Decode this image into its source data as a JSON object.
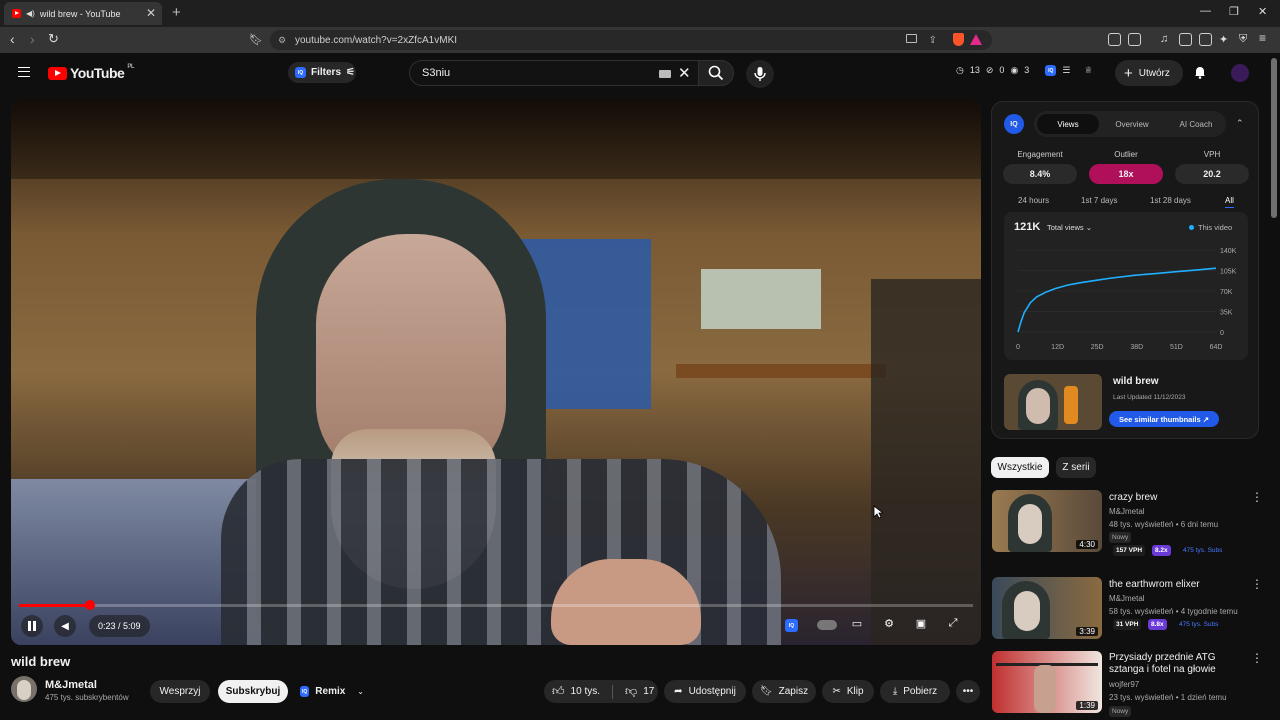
{
  "browser": {
    "tab_title": "wild brew - YouTube",
    "tab_close": "✕",
    "new_tab": "+",
    "url": "youtube.com/watch?v=2xZfcA1vMKI"
  },
  "header": {
    "logo_text": "YouTube",
    "region": "PL",
    "filters_label": "Filters",
    "iq_label": "IQ",
    "search_value": "S3niu",
    "counters": [
      "13",
      "0",
      "3"
    ],
    "create_label": "Utwórz"
  },
  "player": {
    "time": "0:23 / 5:09",
    "progress_fraction": 0.074
  },
  "video": {
    "title": "wild brew",
    "channel": "M&Jmetal",
    "subs": "475 tys. subskrybentów",
    "support_label": "Wesprzyj",
    "subscribe_label": "Subskrybuj",
    "remix_label": "Remix",
    "likes": "10 tys.",
    "dislikes": "17",
    "share_label": "Udostępnij",
    "save_label": "Zapisz",
    "clip_label": "Klip",
    "download_label": "Pobierz"
  },
  "vidiq": {
    "tabs": [
      "Views",
      "Overview",
      "AI Coach"
    ],
    "metrics": [
      {
        "label": "Engagement",
        "value": "8.4%"
      },
      {
        "label": "Outlier",
        "value": "18x"
      },
      {
        "label": "VPH",
        "value": "20.2"
      }
    ],
    "ranges": [
      "24 hours",
      "1st 7 days",
      "1st 28 days",
      "All"
    ],
    "total": "121K",
    "total_select": "Total views",
    "legend": "This video",
    "thumb_title": "wild brew",
    "last_updated": "Last Updated 11/12/2023",
    "similar_button": "See similar thumbnails ↗",
    "accent": "#1fb0ff",
    "outlier_color": "#b0105a"
  },
  "chart_data": {
    "type": "line",
    "x_ticks": [
      "0",
      "12D",
      "25D",
      "38D",
      "51D",
      "64D"
    ],
    "y_ticks": [
      "140K",
      "105K",
      "70K",
      "35K",
      "0"
    ],
    "ylim": [
      0,
      140000
    ],
    "xlim": [
      0,
      64
    ],
    "series": [
      {
        "name": "This video",
        "x": [
          0,
          1,
          2,
          4,
          6,
          9,
          12,
          16,
          20,
          25,
          30,
          38,
          45,
          51,
          58,
          64
        ],
        "y": [
          0,
          18000,
          33000,
          50000,
          60000,
          68000,
          74000,
          80000,
          84000,
          88000,
          92000,
          97000,
          100000,
          103000,
          106000,
          109000
        ]
      }
    ]
  },
  "sidebar": {
    "chips": [
      "Wszystkie",
      "Z serii"
    ],
    "recommendations": [
      {
        "title": "crazy brew",
        "channel": "M&Jmetal",
        "meta": "48 tys. wyświetleń • 6 dni temu",
        "badge": "Nowy",
        "vph": "157 VPH",
        "mult": "8.2x",
        "subs": "475 tys. Subs",
        "duration": "4:30"
      },
      {
        "title": "the earthwrom elixer",
        "channel": "M&Jmetal",
        "meta": "58 tys. wyświetleń • 4 tygodnie temu",
        "badge": "",
        "vph": "31 VPH",
        "mult": "8.8x",
        "subs": "475 tys. Subs",
        "duration": "3:39"
      },
      {
        "title": "Przysiady przednie ATG sztanga i fotel na głowie",
        "channel": "wojfer97",
        "meta": "23 tys. wyświetleń • 1 dzień temu",
        "badge": "Nowy",
        "vph": "",
        "mult": "",
        "subs": "",
        "duration": "1:39"
      }
    ]
  }
}
